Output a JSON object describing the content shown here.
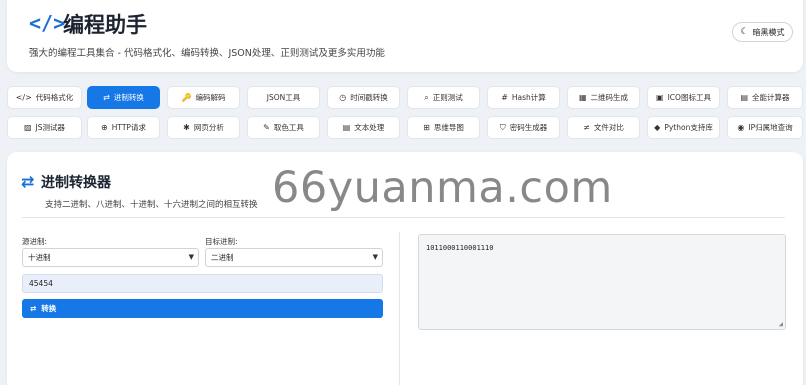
{
  "header": {
    "title": "编程助手",
    "subtitle": "强大的编程工具集合 - 代码格式化、编码转换、JSON处理、正则测试及更多实用功能",
    "dark_mode_label": "暗黑模式"
  },
  "tabs": [
    {
      "label": "代码格式化",
      "icon": "code-icon",
      "glyph": "</>",
      "active": false
    },
    {
      "label": "进制转换",
      "icon": "exchange-icon",
      "glyph": "⇄",
      "active": true
    },
    {
      "label": "编码解码",
      "icon": "key-icon",
      "glyph": "🔑",
      "active": false
    },
    {
      "label": "JSON工具",
      "icon": "braces-icon",
      "glyph": "",
      "active": false
    },
    {
      "label": "时间戳转换",
      "icon": "clock-icon",
      "glyph": "◷",
      "active": false
    },
    {
      "label": "正则测试",
      "icon": "search-icon",
      "glyph": "⌕",
      "active": false
    },
    {
      "label": "Hash计算",
      "icon": "hash-icon",
      "glyph": "#",
      "active": false
    },
    {
      "label": "二维码生成",
      "icon": "qrcode-icon",
      "glyph": "▦",
      "active": false
    },
    {
      "label": "ICO图标工具",
      "icon": "image-icon",
      "glyph": "▣",
      "active": false
    },
    {
      "label": "全能计算器",
      "icon": "calculator-icon",
      "glyph": "▤",
      "active": false
    },
    {
      "label": "JS测试器",
      "icon": "js-icon",
      "glyph": "▨",
      "active": false
    },
    {
      "label": "HTTP请求",
      "icon": "globe-icon",
      "glyph": "⊕",
      "active": false
    },
    {
      "label": "网页分析",
      "icon": "bug-icon",
      "glyph": "✱",
      "active": false
    },
    {
      "label": "取色工具",
      "icon": "eyedropper-icon",
      "glyph": "✎",
      "active": false
    },
    {
      "label": "文本处理",
      "icon": "file-text-icon",
      "glyph": "▤",
      "active": false
    },
    {
      "label": "思维导图",
      "icon": "sitemap-icon",
      "glyph": "⊞",
      "active": false
    },
    {
      "label": "密码生成器",
      "icon": "shield-icon",
      "glyph": "⛉",
      "active": false
    },
    {
      "label": "文件对比",
      "icon": "not-equal-icon",
      "glyph": "≠",
      "active": false
    },
    {
      "label": "Python支持库",
      "icon": "python-icon",
      "glyph": "◆",
      "active": false
    },
    {
      "label": "IP归属地查询",
      "icon": "location-icon",
      "glyph": "◉",
      "active": false
    }
  ],
  "converter": {
    "title": "进制转换器",
    "description": "支持二进制、八进制、十进制、十六进制之间的相互转换",
    "source_label": "源进制:",
    "source_value": "十进制",
    "target_label": "目标进制:",
    "target_value": "二进制",
    "input_value": "45454",
    "convert_label": "转换",
    "result": "1011000110001110"
  },
  "watermark": "66yuanma.com",
  "colors": {
    "accent": "#1677e6",
    "background": "#eef1f5"
  }
}
